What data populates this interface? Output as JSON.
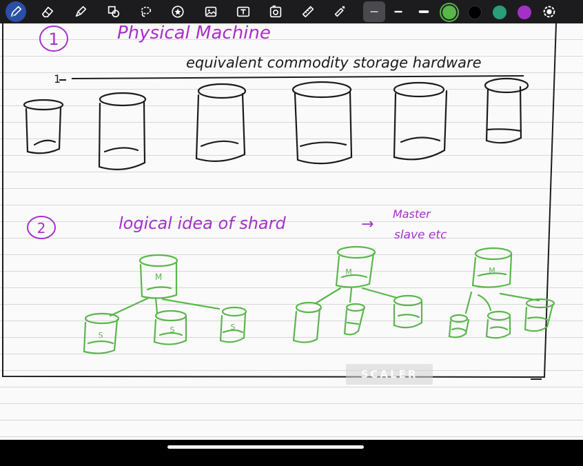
{
  "toolbar": {
    "tools": [
      {
        "id": "pen",
        "icon": "pen-icon"
      },
      {
        "id": "eraser",
        "icon": "eraser-icon"
      },
      {
        "id": "highlighter",
        "icon": "highlighter-icon"
      },
      {
        "id": "shapes",
        "icon": "shapes-icon"
      },
      {
        "id": "lasso",
        "icon": "lasso-icon"
      },
      {
        "id": "sticker",
        "icon": "star-sticker-icon"
      },
      {
        "id": "image",
        "icon": "image-icon"
      },
      {
        "id": "text",
        "icon": "text-box-icon"
      },
      {
        "id": "camera",
        "icon": "camera-icon"
      },
      {
        "id": "ruler",
        "icon": "ruler-icon"
      },
      {
        "id": "laser",
        "icon": "laser-pointer-icon"
      }
    ],
    "stroke_widths": [
      "thin",
      "medium",
      "thick"
    ],
    "colors": [
      {
        "name": "green",
        "hex": "#59b64a",
        "selected": true
      },
      {
        "name": "black",
        "hex": "#000000"
      },
      {
        "name": "teal",
        "hex": "#2a9d7a"
      },
      {
        "name": "purple",
        "hex": "#a530c9"
      }
    ]
  },
  "notes": {
    "heading_number": "1",
    "heading": "Physical Machine",
    "hardware_caption": "equivalent commodity storage hardware",
    "tick_label": "1",
    "section2_number": "2",
    "section2_text": "logical idea of shard",
    "arrow": "→",
    "section2_note_line1": "Master",
    "section2_note_line2": "slave etc",
    "master_label": "M",
    "slave_label": "S"
  },
  "watermark": "SCALER"
}
